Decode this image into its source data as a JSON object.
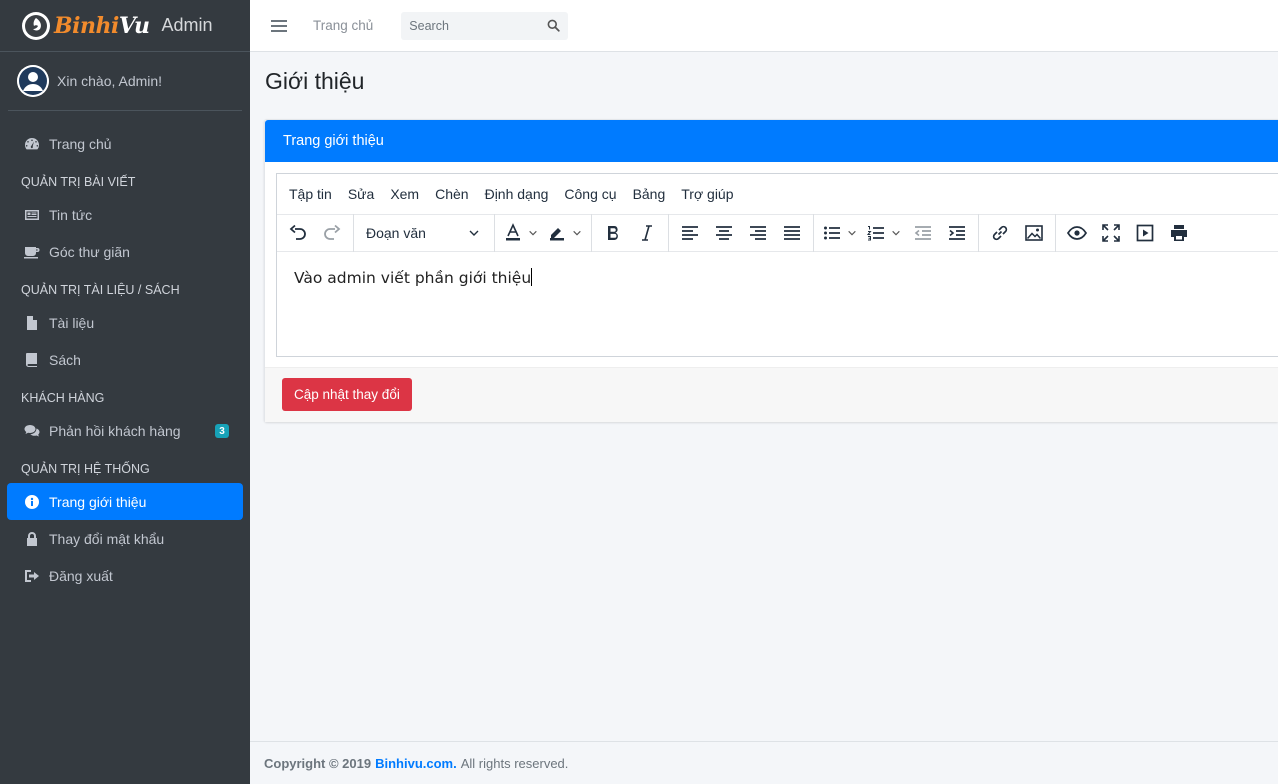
{
  "brand": {
    "name_part1": "Binhi",
    "name_part2": "Vu",
    "admin_label": "Admin"
  },
  "user": {
    "greeting": "Xin chào, Admin!"
  },
  "sidebar": {
    "home": "Trang chủ",
    "sections": [
      {
        "header": "QUẢN TRỊ BÀI VIẾT",
        "items": [
          {
            "label": "Tin tức",
            "icon": "newspaper-icon"
          },
          {
            "label": "Góc thư giãn",
            "icon": "coffee-icon"
          }
        ]
      },
      {
        "header": "QUẢN TRỊ TÀI LIỆU / SÁCH",
        "items": [
          {
            "label": "Tài liệu",
            "icon": "file-icon"
          },
          {
            "label": "Sách",
            "icon": "book-icon"
          }
        ]
      },
      {
        "header": "KHÁCH HÀNG",
        "items": [
          {
            "label": "Phản hồi khách hàng",
            "icon": "comments-icon",
            "badge": "3"
          }
        ]
      },
      {
        "header": "QUẢN TRỊ HỆ THỐNG",
        "items": [
          {
            "label": "Trang giới thiệu",
            "icon": "info-icon",
            "active": true
          },
          {
            "label": "Thay đổi mật khẩu",
            "icon": "lock-icon"
          },
          {
            "label": "Đăng xuất",
            "icon": "sign-out-icon"
          }
        ]
      }
    ]
  },
  "topbar": {
    "home_link": "Trang chủ",
    "search_placeholder": "Search"
  },
  "page": {
    "title": "Giới thiệu"
  },
  "card": {
    "header": "Trang giới thiệu"
  },
  "editor": {
    "menu": [
      "Tập tin",
      "Sửa",
      "Xem",
      "Chèn",
      "Định dạng",
      "Công cụ",
      "Bảng",
      "Trợ giúp"
    ],
    "block_format": "Đoạn văn",
    "content": "Vào admin viết phần giới thiệu"
  },
  "actions": {
    "save_label": "Cập nhật thay đổi"
  },
  "footer": {
    "copyright": "Copyright © 2019",
    "site": "Binhivu.com.",
    "rights": "All rights reserved."
  },
  "colors": {
    "sidebar_bg": "#343a40",
    "primary": "#007bff",
    "danger": "#dc3545",
    "badge": "#17a2b8",
    "brand_orange": "#f28b2c"
  }
}
